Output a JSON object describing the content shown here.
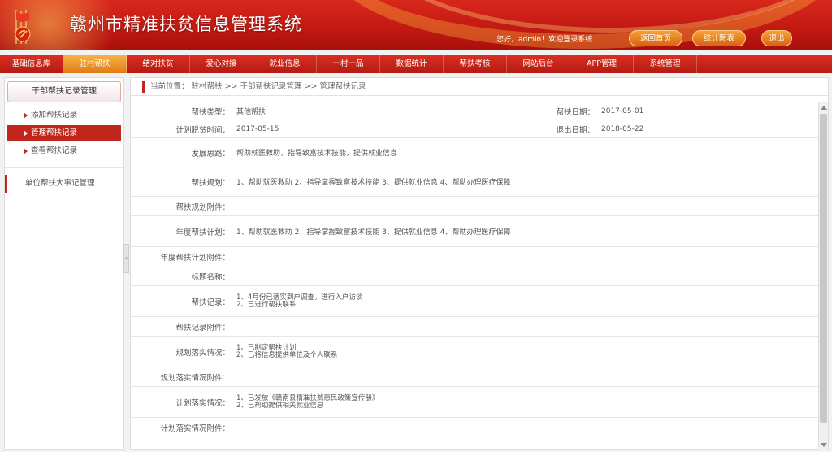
{
  "header": {
    "title": "赣州市精准扶贫信息管理系统",
    "welcome": "您好，admin！欢迎登录系统",
    "buttons": {
      "home": "返回首页",
      "stats": "统计图表",
      "logout": "退出"
    }
  },
  "nav": [
    "基础信息库",
    "驻村帮扶",
    "结对扶贫",
    "爱心对接",
    "就业信息",
    "一村一品",
    "数据统计",
    "帮扶考核",
    "网站后台",
    "APP管理",
    "系统管理"
  ],
  "sidebar": {
    "heading": "干部帮扶记录管理",
    "items": [
      "添加帮扶记录",
      "管理帮扶记录",
      "查看帮扶记录"
    ],
    "group": "单位帮扶大事记管理"
  },
  "breadcrumb": {
    "prefix": "当前位置：",
    "parts": [
      "驻村帮扶",
      ">>",
      "干部帮扶记录管理",
      ">>",
      "管理帮扶记录"
    ]
  },
  "form": {
    "help_type": {
      "label": "帮扶类型：",
      "value": "其他帮扶"
    },
    "help_date": {
      "label": "帮扶日期：",
      "value": "2017-05-01"
    },
    "plan_date": {
      "label": "计划脱贫时间：",
      "value": "2017-05-15"
    },
    "exit_date": {
      "label": "退出日期：",
      "value": "2018-05-22"
    },
    "idea": {
      "label": "发展思路：",
      "value": "帮助就医救助，指导致富技术技能，提供就业信息"
    },
    "plan": {
      "label": "帮扶规划：",
      "value": "1、帮助就医救助 2、指导掌握致富技术技能 3、提供就业信息 4、帮助办理医疗保障"
    },
    "plan_attach": {
      "label": "帮扶规划附件：",
      "value": ""
    },
    "year_plan": {
      "label": "年度帮扶计划：",
      "value": "1、帮助就医救助 2、指导掌握致富技术技能 3、提供就业信息 4、帮助办理医疗保障"
    },
    "year_plan_attach": {
      "label": "年度帮扶计划附件：",
      "value": ""
    },
    "title_name": {
      "label": "标题名称：",
      "value": ""
    },
    "record": {
      "label": "帮扶记录：",
      "lines": [
        "1、4月份已落实到户调查，进行入户访谈",
        "2、已进行帮扶联系"
      ]
    },
    "record_attach": {
      "label": "帮扶记录附件：",
      "value": ""
    },
    "plan_impl": {
      "label": "规划落实情况：",
      "lines": [
        "1、已制定帮扶计划",
        "2、已将信息提供单位及个人联系"
      ]
    },
    "plan_impl_attach": {
      "label": "规划落实情况附件：",
      "value": ""
    },
    "year_impl": {
      "label": "计划落实情况：",
      "lines": [
        "1、已发放《赣南县精准扶贫惠民政策宣传册》",
        "2、已帮助提供相关就业信息"
      ]
    },
    "year_impl_attach": {
      "label": "计划落实情况附件：",
      "value": ""
    }
  }
}
